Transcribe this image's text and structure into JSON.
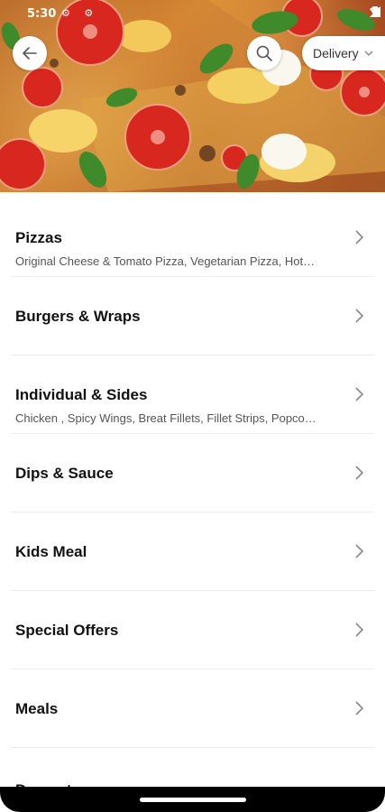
{
  "status": {
    "time": "5:30"
  },
  "header": {
    "delivery_label": "Delivery"
  },
  "categories": [
    {
      "title": "Pizzas",
      "subtitle": "Original Cheese & Tomato Pizza, Vegetarian Pizza, Hot…"
    },
    {
      "title": "Burgers & Wraps",
      "subtitle": ""
    },
    {
      "title": "Individual & Sides",
      "subtitle": "Chicken , Spicy Wings, Breat Fillets, Fillet Strips, Popco…"
    },
    {
      "title": "Dips & Sauce",
      "subtitle": ""
    },
    {
      "title": "Kids Meal",
      "subtitle": ""
    },
    {
      "title": "Special Offers",
      "subtitle": ""
    },
    {
      "title": "Meals",
      "subtitle": ""
    },
    {
      "title": "Desserts",
      "subtitle": ""
    }
  ],
  "colors": {
    "accent": "#111111",
    "divider": "#ececec"
  }
}
